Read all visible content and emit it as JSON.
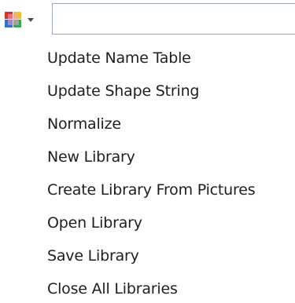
{
  "toolbar": {
    "library_button": {
      "icon": "color-library-icon",
      "dropdown_icon": "chevron-down-icon"
    },
    "search": {
      "value": "",
      "placeholder": ""
    }
  },
  "menu": {
    "items": [
      {
        "label": "Update Name Table"
      },
      {
        "label": "Update Shape String"
      },
      {
        "label": "Normalize"
      },
      {
        "label": "New Library"
      },
      {
        "label": "Create Library From Pictures"
      },
      {
        "label": "Open Library"
      },
      {
        "label": "Save Library"
      },
      {
        "label": "Close All Libraries"
      }
    ]
  },
  "colors": {
    "text": "#1e1e1e",
    "input_border": "#9aa7b6",
    "icon_red": "#d9342b",
    "icon_blue": "#2f6fd6",
    "icon_yellow": "#f2c21b",
    "icon_green": "#3aa655"
  }
}
